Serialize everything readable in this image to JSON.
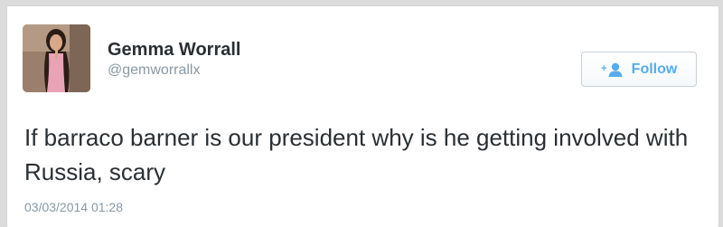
{
  "tweet": {
    "author": {
      "name": "Gemma Worrall",
      "handle": "@gemworrallx"
    },
    "follow_button": {
      "label": "Follow",
      "icon": "add-user-icon"
    },
    "text": "If barraco barner is our president why is he getting involved with Russia, scary",
    "timestamp": "03/03/2014 01:28"
  },
  "colors": {
    "name": "#292f33",
    "handle": "#8899a6",
    "follow_accent": "#55acee",
    "text": "#292f33"
  }
}
